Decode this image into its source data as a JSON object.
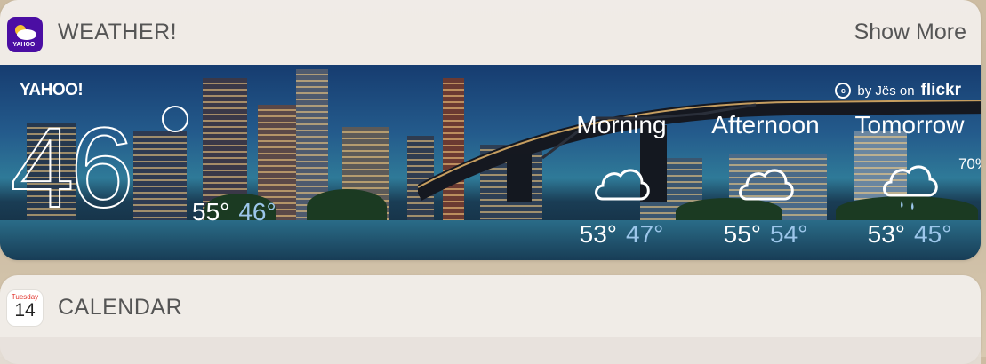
{
  "weather_widget": {
    "title": "WEATHER!",
    "show_more": "Show More",
    "app_icon": "yahoo-weather-app-icon",
    "app_icon_text": "YAHOO!",
    "brand": "YAHOO!",
    "photo_credit": "by Jës on",
    "photo_credit_site": "flickr",
    "current": {
      "temp": "46",
      "high": "55°",
      "low": "46°"
    },
    "forecast": [
      {
        "label": "Morning",
        "icon": "cloud-icon",
        "high": "53°",
        "low": "47°"
      },
      {
        "label": "Afternoon",
        "icon": "cloud-icon",
        "high": "55°",
        "low": "54°"
      },
      {
        "label": "Tomorrow",
        "icon": "rain-cloud-icon",
        "precip": "70%",
        "high": "53°",
        "low": "45°"
      }
    ],
    "colors": {
      "icon_bg": "#4b0ea3",
      "low_temp": "#9cc6ea"
    }
  },
  "calendar_widget": {
    "title": "CALENDAR",
    "icon_weekday": "Tuesday",
    "icon_day": "14"
  }
}
